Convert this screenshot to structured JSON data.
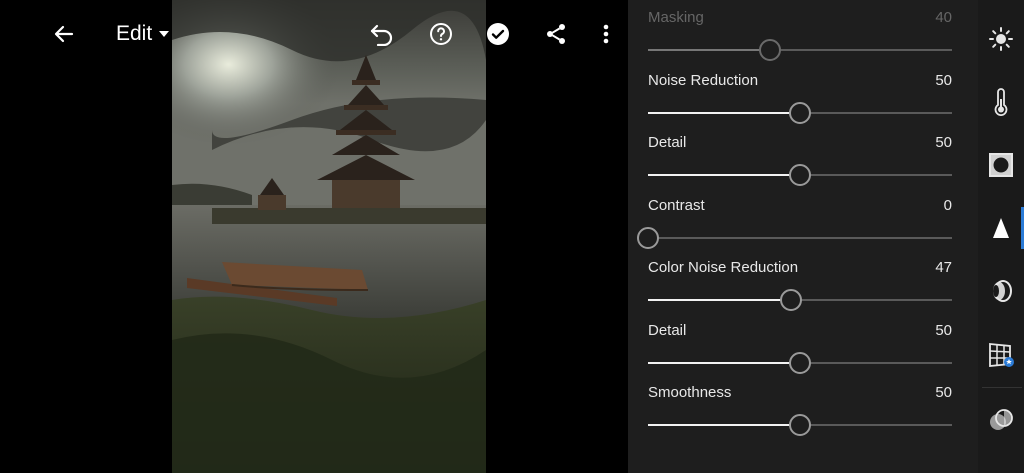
{
  "topbar": {
    "edit_label": "Edit",
    "icons": [
      "back-arrow-icon",
      "dropdown-caret-icon",
      "undo-icon",
      "help-icon",
      "checkmark-icon",
      "share-icon",
      "more-vertical-icon"
    ]
  },
  "panel": {
    "sliders": [
      {
        "label": "Masking",
        "value": "40",
        "level": 40,
        "enabled": false
      },
      {
        "label": "Noise Reduction",
        "value": "50",
        "level": 50,
        "enabled": true
      },
      {
        "label": "Detail",
        "value": "50",
        "level": 50,
        "enabled": true
      },
      {
        "label": "Contrast",
        "value": "0",
        "level": 0,
        "enabled": true
      },
      {
        "label": "Color Noise Reduction",
        "value": "47",
        "level": 47,
        "enabled": true
      },
      {
        "label": "Detail",
        "value": "50",
        "level": 50,
        "enabled": true
      },
      {
        "label": "Smoothness",
        "value": "50",
        "level": 50,
        "enabled": true
      }
    ]
  },
  "sidebar": {
    "tools": [
      "light-icon",
      "color-temperature-icon",
      "effects-vignette-icon",
      "detail-triangle-icon",
      "optics-lens-icon",
      "geometry-grid-icon",
      "presets-overlay-icon"
    ],
    "active_tool": "detail-triangle-icon",
    "accent_color": "#2b7bd6"
  },
  "colors": {
    "panel_bg": "#1e1e1e",
    "sidebar_bg": "#1a1a1a",
    "accent": "#2b7bd6"
  }
}
